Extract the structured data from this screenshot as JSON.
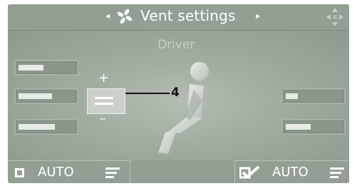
{
  "header": {
    "title": "Vent settings",
    "left_arrow": "◂",
    "right_arrow": "▸",
    "fan_icon": "fan-icon",
    "nav_icon": "navigation-arrows-icon"
  },
  "zone_label": "Driver",
  "left_vent_levels": [
    0.45,
    0.6,
    0.65
  ],
  "right_vent_levels": [
    0.22,
    0.45
  ],
  "stepper": {
    "plus_label": "+",
    "minus_label": "–",
    "callout": "4"
  },
  "footer": {
    "left_auto_label": "AUTO",
    "right_auto_label": "AUTO",
    "left_checkbox_checked": false,
    "right_checkbox_checked": true
  },
  "colors": {
    "background": "#9aa69b",
    "text": "#ffffff",
    "subtitle": "#c8cfc6"
  }
}
